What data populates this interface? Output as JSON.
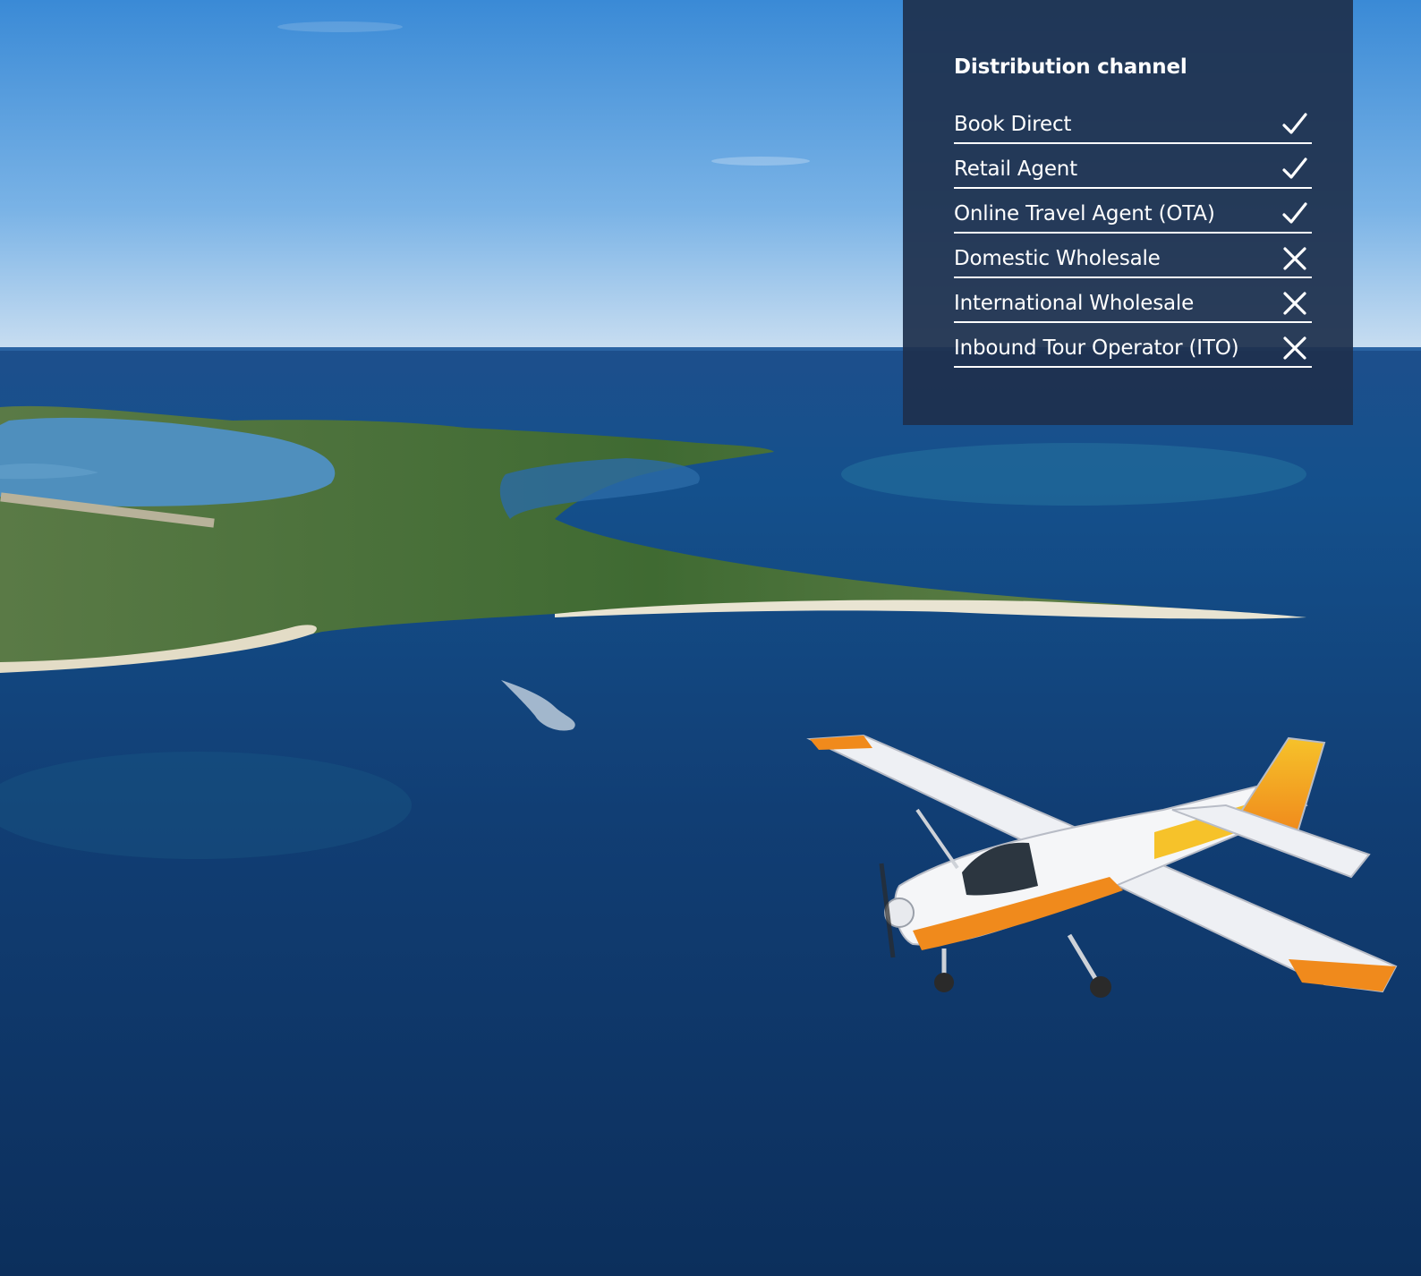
{
  "panel": {
    "title": "Distribution channel",
    "rows": [
      {
        "label": "Book Direct",
        "available": true
      },
      {
        "label": "Retail Agent",
        "available": true
      },
      {
        "label": "Online Travel Agent (OTA)",
        "available": true
      },
      {
        "label": "Domestic Wholesale",
        "available": false
      },
      {
        "label": "International Wholesale",
        "available": false
      },
      {
        "label": "Inbound Tour Operator (ITO)",
        "available": false
      }
    ],
    "mark_icons": {
      "available": "check-icon",
      "unavailable": "cross-icon"
    }
  },
  "colors": {
    "panel_bg": "#1e304e",
    "text": "#ffffff",
    "sky_top": "#3f8fd9",
    "ocean": "#0d3566",
    "plane_orange": "#f08a1c"
  }
}
